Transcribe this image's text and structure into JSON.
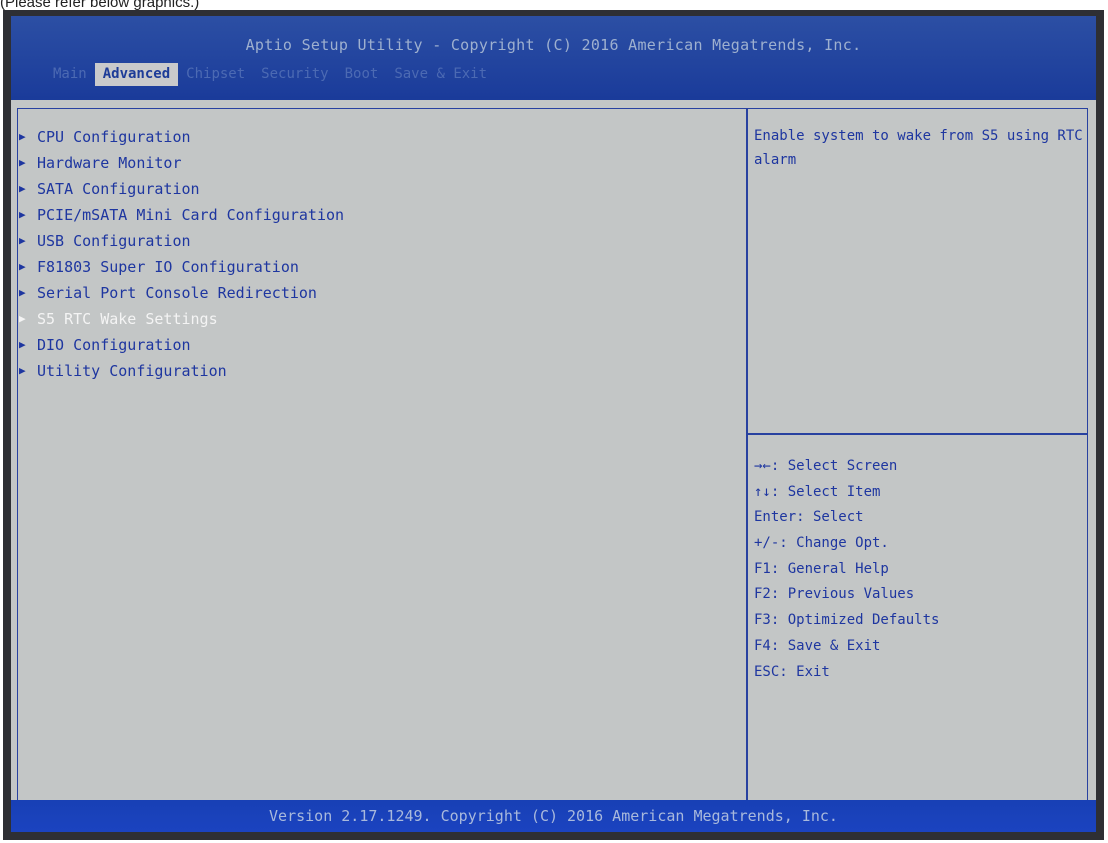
{
  "caption": "(Please refer below graphics.)",
  "header": {
    "title": "Aptio Setup Utility - Copyright (C) 2016 American Megatrends, Inc.",
    "tabs": [
      "Main",
      "Advanced",
      "Chipset",
      "Security",
      "Boot",
      "Save & Exit"
    ],
    "active_tab": "Advanced"
  },
  "menu": {
    "items": [
      "CPU Configuration",
      "Hardware Monitor",
      "SATA Configuration",
      "PCIE/mSATA Mini Card Configuration",
      "USB Configuration",
      "F81803 Super IO Configuration",
      "Serial Port Console Redirection",
      "S5 RTC Wake Settings",
      "DIO Configuration",
      "Utility Configuration"
    ],
    "selected": "S5 RTC Wake Settings",
    "arrow_icon": "triangle-right-icon"
  },
  "help": {
    "text": "Enable system to wake from S5 using RTC alarm"
  },
  "keys": [
    "→←: Select Screen",
    "↑↓: Select Item",
    "Enter: Select",
    "+/-: Change Opt.",
    "F1: General Help",
    "F2: Previous Values",
    "F3: Optimized Defaults",
    "F4: Save & Exit",
    "ESC: Exit"
  ],
  "footer": {
    "text": "Version 2.17.1249. Copyright (C) 2016 American Megatrends, Inc."
  },
  "colors": {
    "header_blue": "#1a3b9a",
    "body_gray": "#c3c6c6",
    "text_blue": "#1e36a0",
    "selected_text": "#f4f4f4"
  }
}
